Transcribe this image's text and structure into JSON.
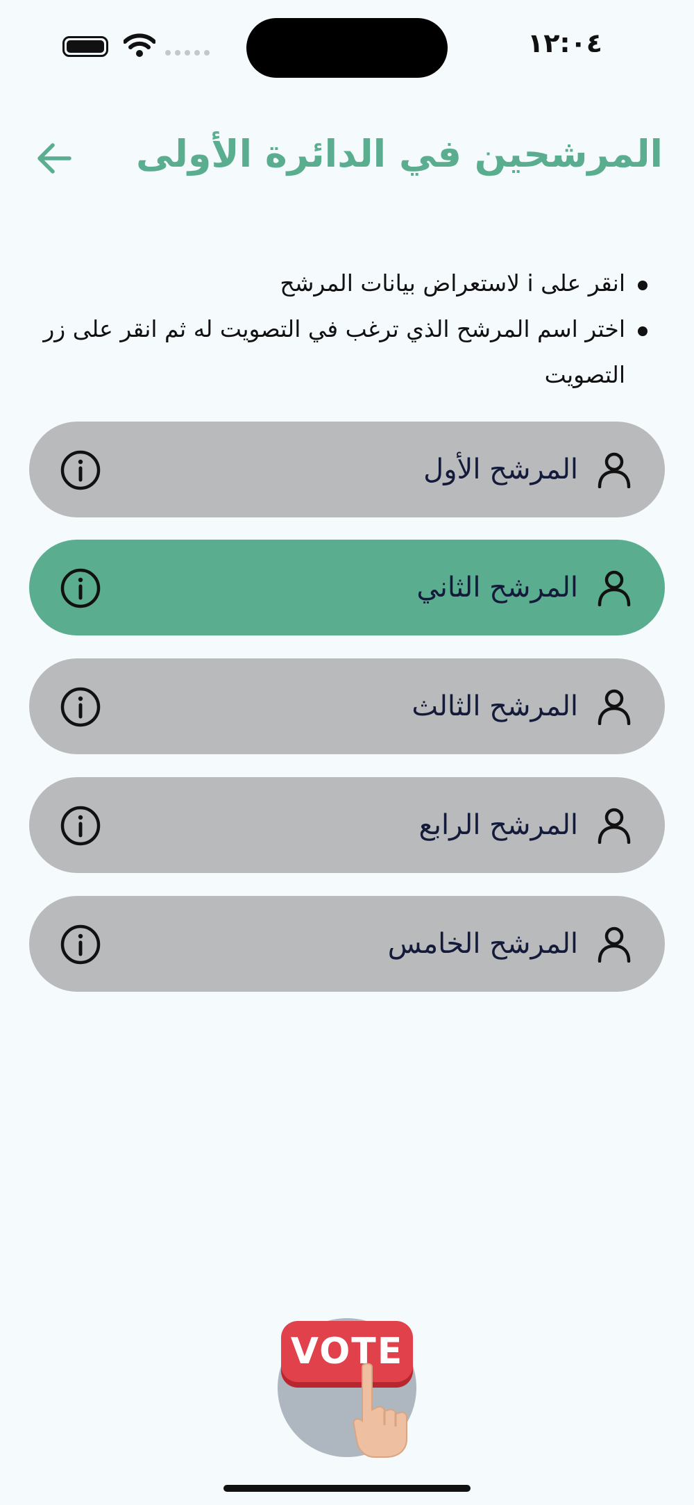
{
  "status_bar": {
    "time": "١٢:٠٤",
    "battery_icon": "battery-icon",
    "wifi_icon": "wifi-icon",
    "signal_icon": "signal-dots-icon"
  },
  "header": {
    "title": "المرشحين في الدائرة الأولى",
    "back_icon": "arrow-left-icon"
  },
  "instructions": [
    "انقر على i لاستعراض بيانات المرشح",
    "اختر اسم المرشح الذي ترغب في التصويت له ثم انقر على زر التصويت"
  ],
  "candidates": [
    {
      "name": "المرشح الأول",
      "selected": false
    },
    {
      "name": "المرشح الثاني",
      "selected": true
    },
    {
      "name": "المرشح الثالث",
      "selected": false
    },
    {
      "name": "المرشح الرابع",
      "selected": false
    },
    {
      "name": "المرشح الخامس",
      "selected": false
    }
  ],
  "vote_button": {
    "label": "VOTE",
    "icon": "vote-hand-icon"
  },
  "colors": {
    "accent": "#5aad8f",
    "background": "#f5fafd",
    "card": "#b9babb",
    "vote_red": "#e0414a"
  }
}
